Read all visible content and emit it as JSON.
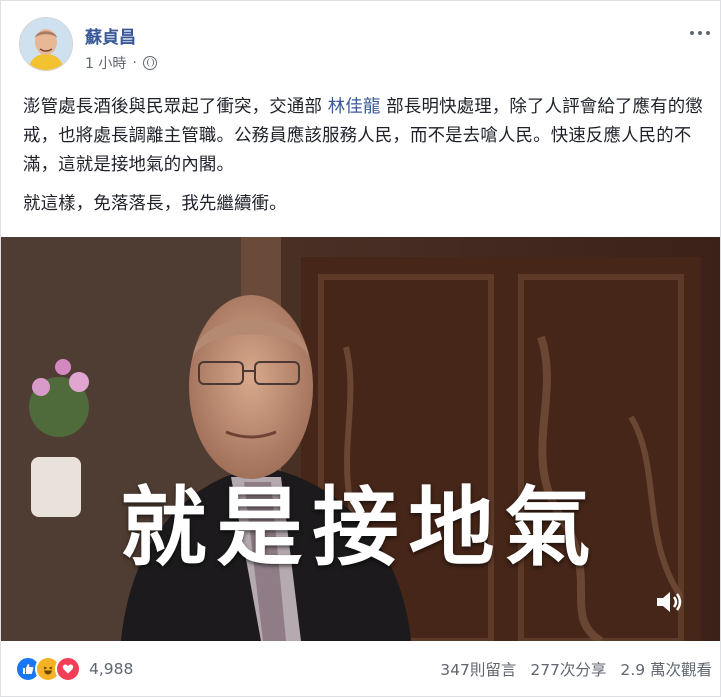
{
  "author": {
    "name": "蘇貞昌"
  },
  "post_meta": {
    "time": "1 小時",
    "privacy_icon": "globe-icon"
  },
  "text": {
    "line1_before": "澎管處長酒後與民眾起了衝突，交通部 ",
    "mention": "林佳龍",
    "line1_after": " 部長明快處理，除了人評會給了應有的懲戒，也將處長調離主管職。公務員應該服務人民，而不是去嗆人民。快速反應人民的不滿，這就是接地氣的內閣。",
    "paragraph2": "就這樣，免落落長，我先繼續衝。"
  },
  "video": {
    "caption": "就是接地氣",
    "volume_icon": "speaker-icon"
  },
  "footer": {
    "reaction_count": "4,988",
    "reactions": [
      "like",
      "haha",
      "love"
    ],
    "comments": "347則留言",
    "shares": "277次分享",
    "views": "2.9 萬次觀看"
  },
  "colors": {
    "link": "#385898",
    "like": "#1877f2",
    "haha": "#f7b125",
    "love": "#f33e58"
  }
}
